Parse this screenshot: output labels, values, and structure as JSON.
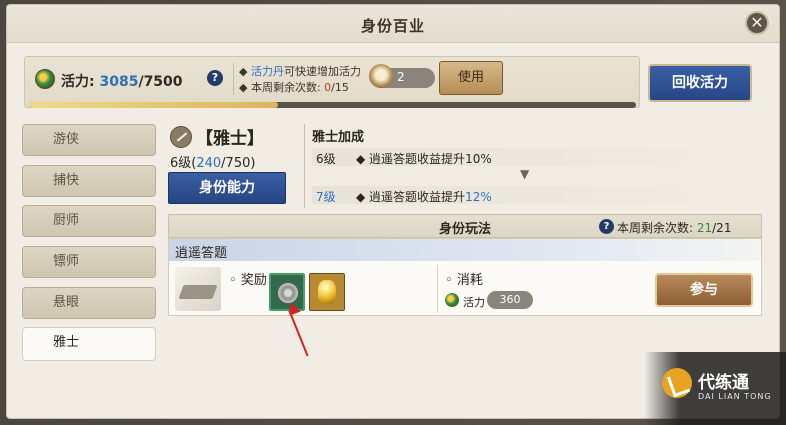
{
  "window": {
    "title": "身份百业"
  },
  "vigor": {
    "label": "活力:",
    "current": "3085",
    "max": "/7500",
    "progress": 0.41
  },
  "tips": {
    "line1_highlight": "活力丹",
    "line1_rest": "可快速增加活力",
    "line2_prefix": "本周剩余次数: ",
    "line2_count": "0",
    "line2_total": "/15"
  },
  "item": {
    "count": "2",
    "use_label": "使用"
  },
  "recover_label": "回收活力",
  "sidebar": {
    "items": [
      {
        "label": "游侠"
      },
      {
        "label": "捕快"
      },
      {
        "label": "厨师"
      },
      {
        "label": "镖师"
      },
      {
        "label": "悬眼"
      },
      {
        "label": "雅士"
      }
    ],
    "active_index": 5
  },
  "identity": {
    "name": "【雅士】",
    "level_prefix": "6级(",
    "exp_cur": "240",
    "exp_max": "/750)",
    "ability_label": "身份能力"
  },
  "bonus": {
    "title": "雅士加成",
    "rows": [
      {
        "level": "6级",
        "text_prefix": "逍遥答题收益提升",
        "value": "10%"
      },
      {
        "level": "7级",
        "text_prefix": "逍遥答题收益提升",
        "value": "12%"
      }
    ]
  },
  "gameplay": {
    "title": "身份玩法",
    "remain_label": "本周剩余次数: ",
    "remain_cur": "21",
    "remain_total": "/21",
    "activity": {
      "name": "逍遥答题",
      "reward_label": "奖励",
      "cost_label": "消耗",
      "cost_type": "活力",
      "cost_value": "360",
      "join_label": "参与"
    }
  },
  "watermark": {
    "title": "代练通",
    "subtitle": "DAI LIAN TONG"
  },
  "colors": {
    "accent_blue": "#2e6fb8",
    "button_blue": "#2f52a0",
    "warning_red": "#c0392b",
    "ok_green": "#2e8b3a"
  }
}
